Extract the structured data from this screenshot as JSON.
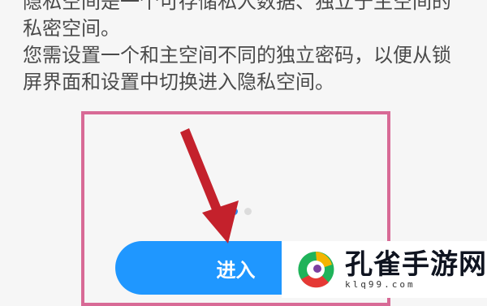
{
  "description": {
    "line1": "隐私空间是一个可存储私人数据、独立于主空间的",
    "line2": "私密空间。",
    "line3": "您需设置一个和主空间不同的独立密码，以便从锁",
    "line4": "屏界面和设置中切换进入隐私空间。"
  },
  "pager": {
    "count": 2,
    "active_index": 0
  },
  "enter_button": {
    "label": "进入"
  },
  "watermark": {
    "title": "孔雀手游网",
    "subtitle": "klq99.com"
  },
  "colors": {
    "button": "#1f97ff",
    "frame": "#d86a96",
    "arrow": "#c4212c"
  }
}
